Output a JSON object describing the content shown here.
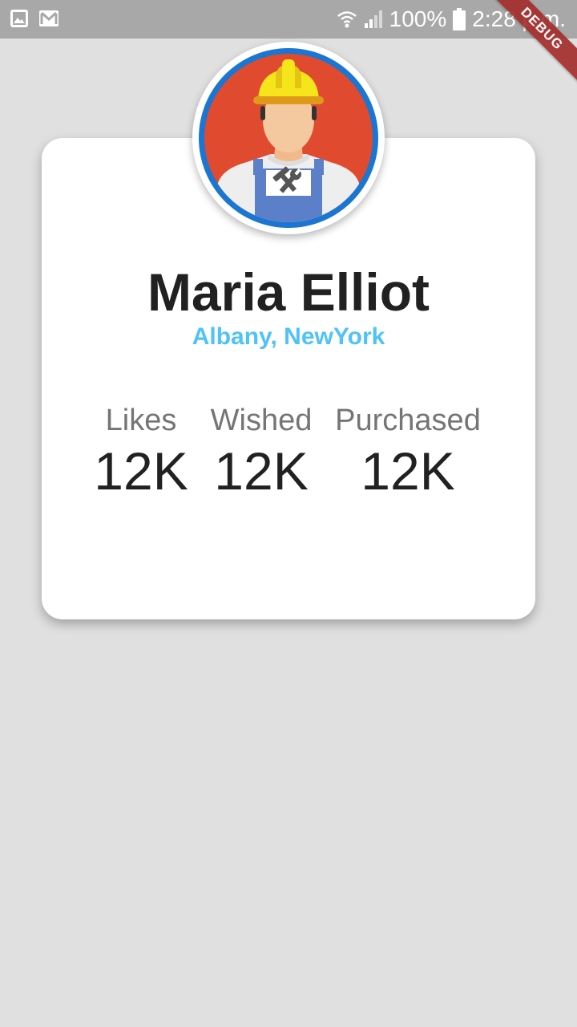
{
  "status_bar": {
    "left_icons": [
      "image-icon",
      "gmail-icon"
    ],
    "right_icons": [
      "wifi-icon",
      "signal-icon",
      "battery-icon"
    ],
    "battery": "100%",
    "time": "2:28 p.m."
  },
  "debug_banner": "DEBUG",
  "profile": {
    "avatar_icon": "worker-icon",
    "name": "Maria Elliot",
    "location": "Albany, NewYork"
  },
  "stats": [
    {
      "label": "Likes",
      "value": "12K"
    },
    {
      "label": "Wished",
      "value": "12K"
    },
    {
      "label": "Purchased",
      "value": "12K"
    }
  ],
  "colors": {
    "background": "#e0e0e0",
    "status_bar": "#a8a8a8",
    "card": "#ffffff",
    "name": "#212121",
    "location": "#4fc3f7",
    "stat_label": "#757575",
    "avatar_ring": "#1976d2",
    "avatar_bg": "#e04a2f",
    "debug_ribbon": "#a52a2a"
  }
}
